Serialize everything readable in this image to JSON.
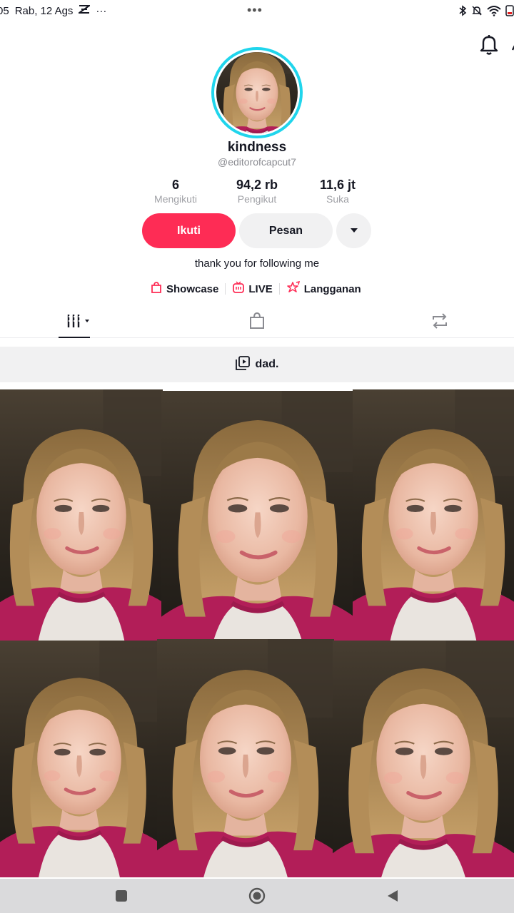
{
  "status_bar": {
    "time": "05",
    "date": "Rab, 12 Ags",
    "center_dots": "•••",
    "left_more": "···"
  },
  "profile": {
    "name": "kindness",
    "handle": "@editorofcapcut7",
    "bio": "thank you for following me",
    "verified_ring_color": "#20d5ec"
  },
  "stats": [
    {
      "value": "6",
      "label": "Mengikuti"
    },
    {
      "value": "94,2 rb",
      "label": "Pengikut"
    },
    {
      "value": "11,6 jt",
      "label": "Suka"
    }
  ],
  "actions": {
    "follow_label": "Ikuti",
    "message_label": "Pesan",
    "follow_color": "#fe2c55"
  },
  "links": [
    {
      "label": "Showcase",
      "icon": "shopping-bag-icon"
    },
    {
      "label": "LIVE",
      "icon": "live-tv-icon"
    },
    {
      "label": "Langganan",
      "icon": "subscription-star-icon"
    }
  ],
  "tabs": [
    {
      "name": "videos-grid",
      "icon": "grid-icon",
      "active": true
    },
    {
      "name": "showcase",
      "icon": "shopping-bag-icon",
      "active": false
    },
    {
      "name": "reposts",
      "icon": "repost-icon",
      "active": false
    }
  ],
  "playlist": {
    "title": "dad.",
    "icon": "playlist-icon"
  },
  "videos": [
    {
      "thumb": "girl-selfie-video"
    },
    {
      "thumb": "girl-selfie-video"
    },
    {
      "thumb": "girl-selfie-video"
    },
    {
      "thumb": "girl-selfie-video"
    },
    {
      "thumb": "girl-selfie-video"
    },
    {
      "thumb": "girl-selfie-video"
    }
  ],
  "nav": [
    "square-recents-icon",
    "circle-home-icon",
    "triangle-back-icon"
  ]
}
